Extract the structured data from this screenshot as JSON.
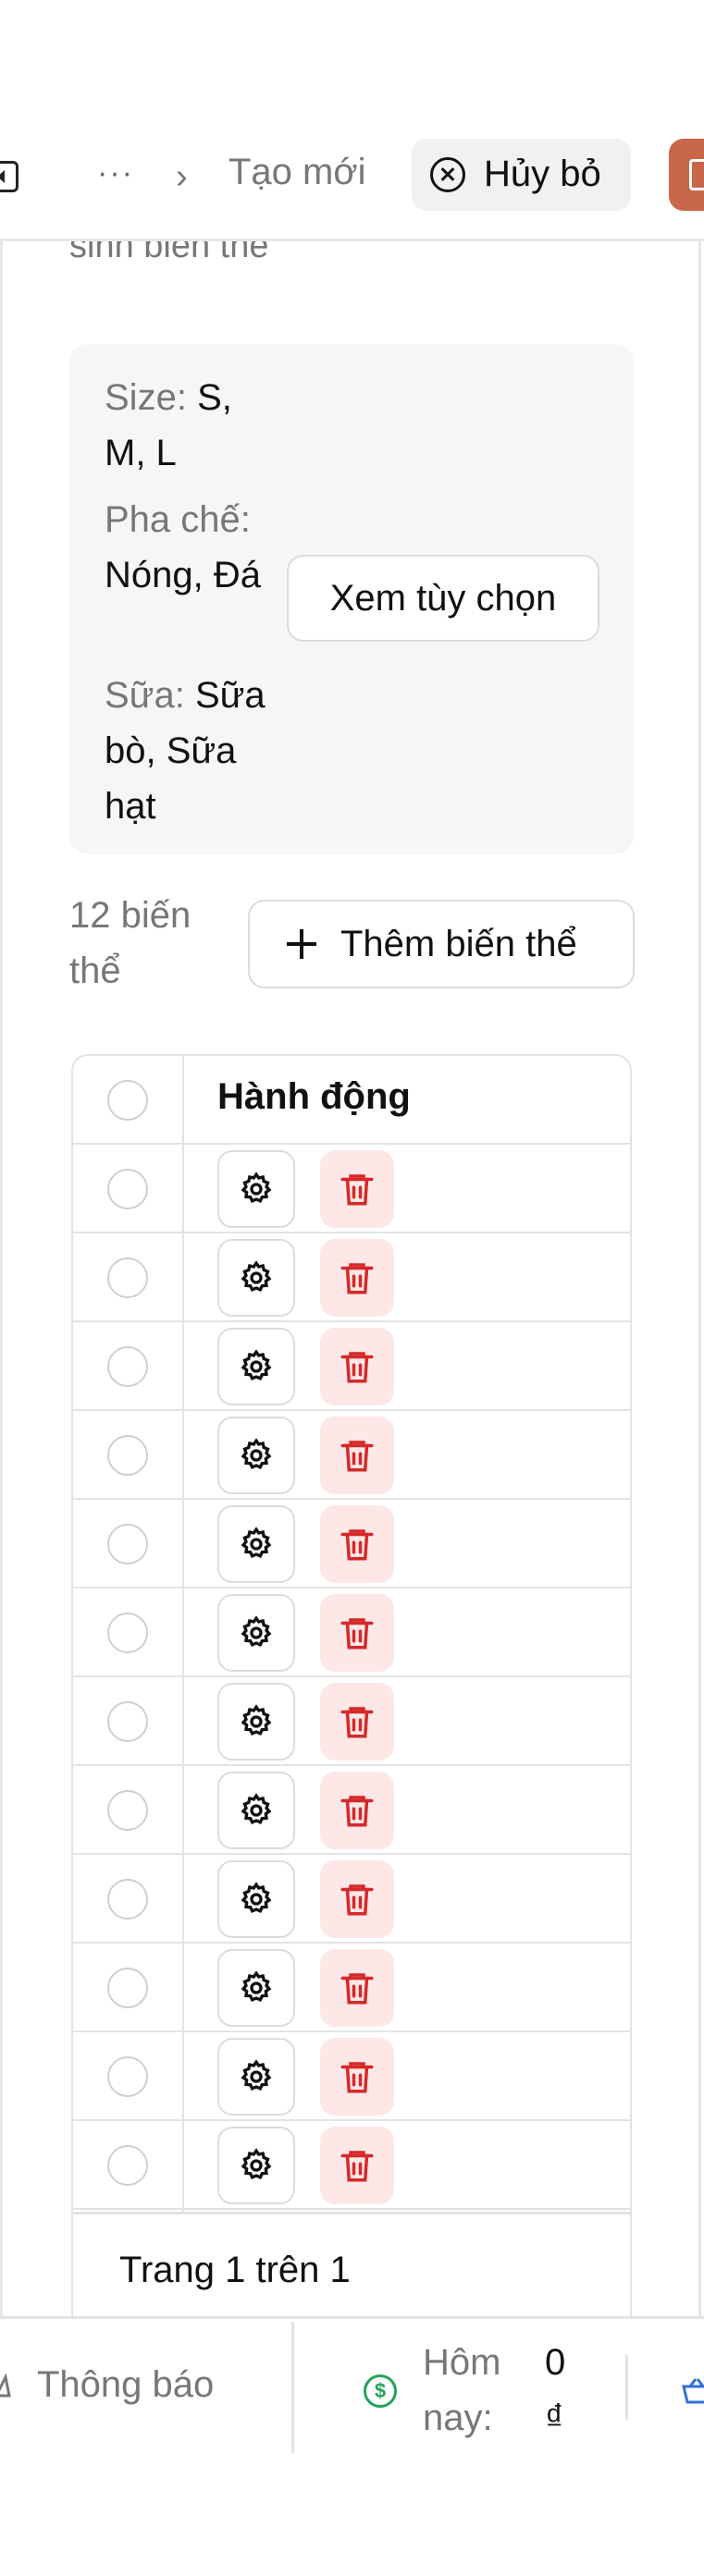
{
  "header": {
    "breadcrumb_more": "···",
    "breadcrumb_sep": "›",
    "breadcrumb_current": "Tạo mới",
    "cancel_label": "Hủy bỏ"
  },
  "section": {
    "description": "sinh biến thể"
  },
  "options": {
    "size_key": "Size:",
    "size_value": "S, M, L",
    "brew_key": "Pha chế:",
    "brew_value": "Nóng, Đá",
    "milk_key": "Sữa:",
    "milk_value": "Sữa bò, Sữa hạt",
    "view_options_label": "Xem tùy chọn"
  },
  "variants": {
    "count_label": "12 biến thể",
    "add_label": "Thêm biến thể"
  },
  "table": {
    "header_actions": "Hành động",
    "row_count": 12,
    "pagination": "Trang 1 trên 1"
  },
  "statusbar": {
    "notifications_label": "Thông báo",
    "today_label": "Hôm nay:",
    "today_value": "0 ₫"
  },
  "colors": {
    "accent": "#c8674a",
    "danger": "#d62828",
    "danger_bg": "#fde7e7",
    "success": "#23a35a"
  }
}
